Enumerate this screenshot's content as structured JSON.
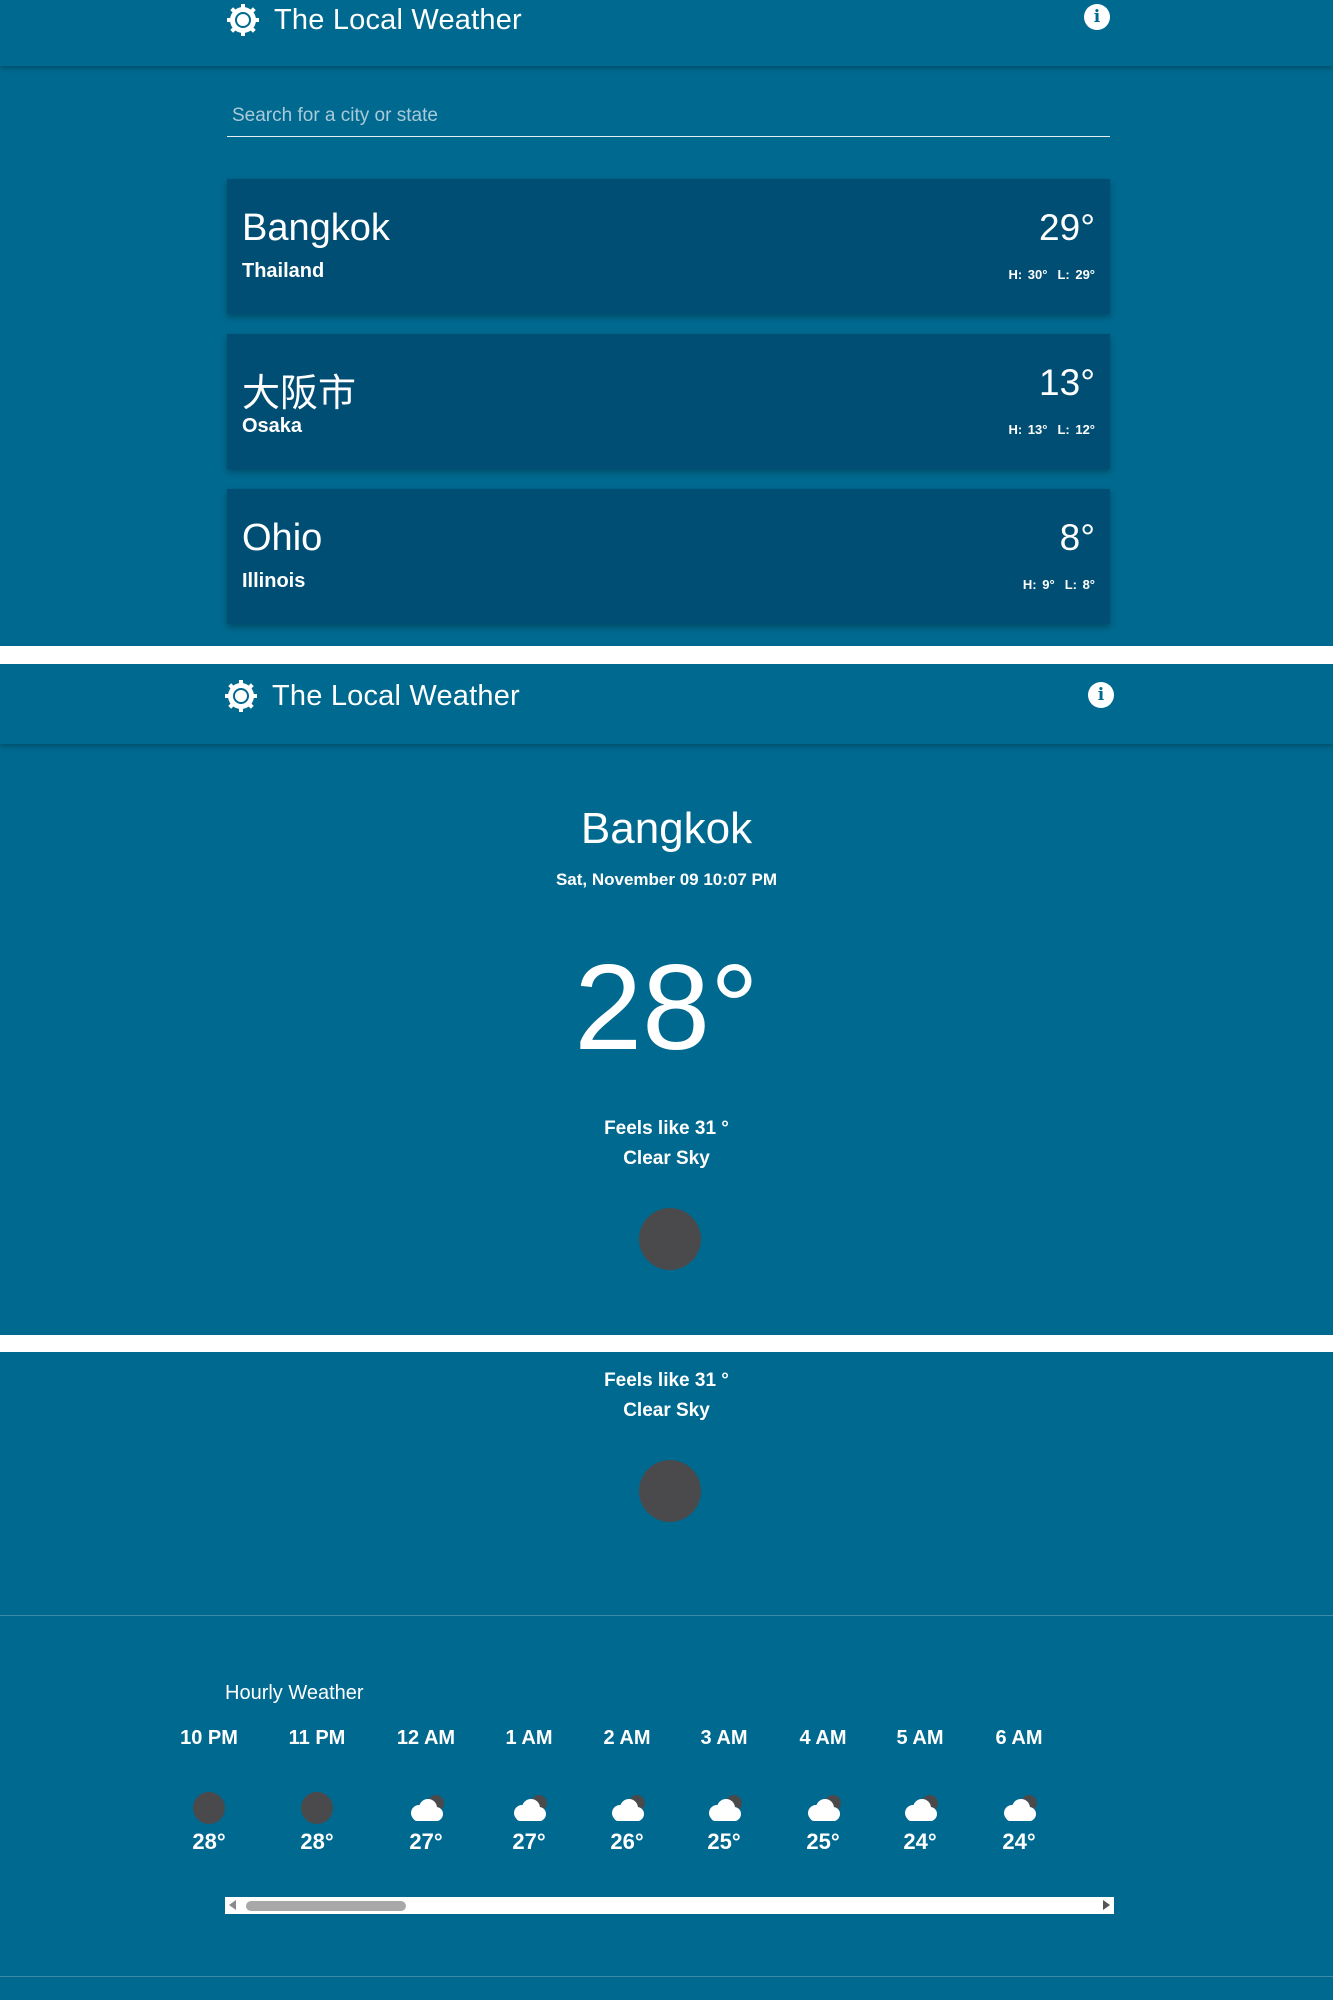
{
  "app": {
    "title": "The Local Weather"
  },
  "icons": {
    "brand": "sun-gear-icon",
    "info": "info-icon",
    "moon": "moon-icon",
    "cloud": "partly-cloudy-night-icon"
  },
  "colors": {
    "background": "#00698f",
    "card": "#004e73",
    "moon": "#4a4a4c"
  },
  "search": {
    "placeholder": "Search for a city or state",
    "value": ""
  },
  "saved_cities": [
    {
      "name": "Bangkok",
      "region": "Thailand",
      "temp": "29°",
      "high": "H: 30°",
      "low": "L: 29°"
    },
    {
      "name": "大阪市",
      "region": "Osaka",
      "temp": "13°",
      "high": "H: 13°",
      "low": "L: 12°"
    },
    {
      "name": "Ohio",
      "region": "Illinois",
      "temp": "8°",
      "high": "H: 9°",
      "low": "L: 8°"
    }
  ],
  "detail": {
    "city": "Bangkok",
    "datetime": "Sat, November 09 10:07 PM",
    "temp": "28°",
    "feels_like": "Feels like 31 °",
    "condition": "Clear Sky"
  },
  "hourly": {
    "title": "Hourly Weather",
    "items": [
      {
        "time": "10 PM",
        "icon": "moon",
        "temp": "28°"
      },
      {
        "time": "11 PM",
        "icon": "moon",
        "temp": "28°"
      },
      {
        "time": "12 AM",
        "icon": "cloud",
        "temp": "27°"
      },
      {
        "time": "1 AM",
        "icon": "cloud",
        "temp": "27°"
      },
      {
        "time": "2 AM",
        "icon": "cloud",
        "temp": "26°"
      },
      {
        "time": "3 AM",
        "icon": "cloud",
        "temp": "25°"
      },
      {
        "time": "4 AM",
        "icon": "cloud",
        "temp": "25°"
      },
      {
        "time": "5 AM",
        "icon": "cloud",
        "temp": "24°"
      },
      {
        "time": "6 AM",
        "icon": "cloud",
        "temp": "24°"
      }
    ]
  }
}
